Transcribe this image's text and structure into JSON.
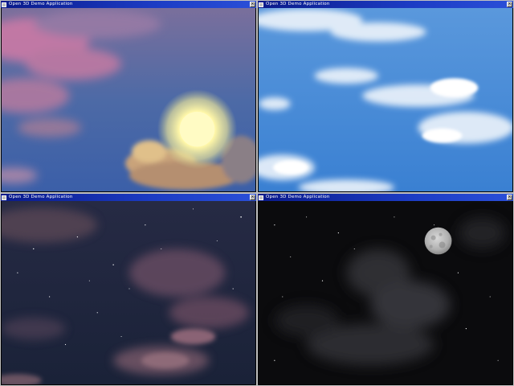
{
  "windows": [
    {
      "id": "win-tl",
      "title": "Open 3D Demo Application",
      "scene": "sunset-sky-with-sun",
      "icons": [
        "window-app-icon",
        "close-icon"
      ]
    },
    {
      "id": "win-tr",
      "title": "Open 3D Demo Application",
      "scene": "daytime-blue-sky",
      "icons": [
        "window-app-icon",
        "close-icon"
      ]
    },
    {
      "id": "win-bl",
      "title": "Open 3D Demo Application",
      "scene": "dusk-sky-with-stars",
      "icons": [
        "window-app-icon",
        "close-icon"
      ]
    },
    {
      "id": "win-br",
      "title": "Open 3D Demo Application",
      "scene": "night-sky-with-moon",
      "icons": [
        "window-app-icon",
        "close-icon"
      ]
    }
  ],
  "colors": {
    "titlebar": "#1c3cc4",
    "sunset_sky": "#4a6aa8",
    "sunset_cloud": "#c97fa6",
    "sun": "#fffbc0",
    "day_sky": "#3f86d6",
    "day_cloud": "#f2f6fb",
    "dusk_sky": "#1e2540",
    "dusk_cloud": "#6e4f66",
    "night_sky": "#0a0a0c",
    "night_cloud": "#3a3a3e",
    "moon": "#bcbcbc"
  },
  "button_glyphs": {
    "close": "×"
  }
}
